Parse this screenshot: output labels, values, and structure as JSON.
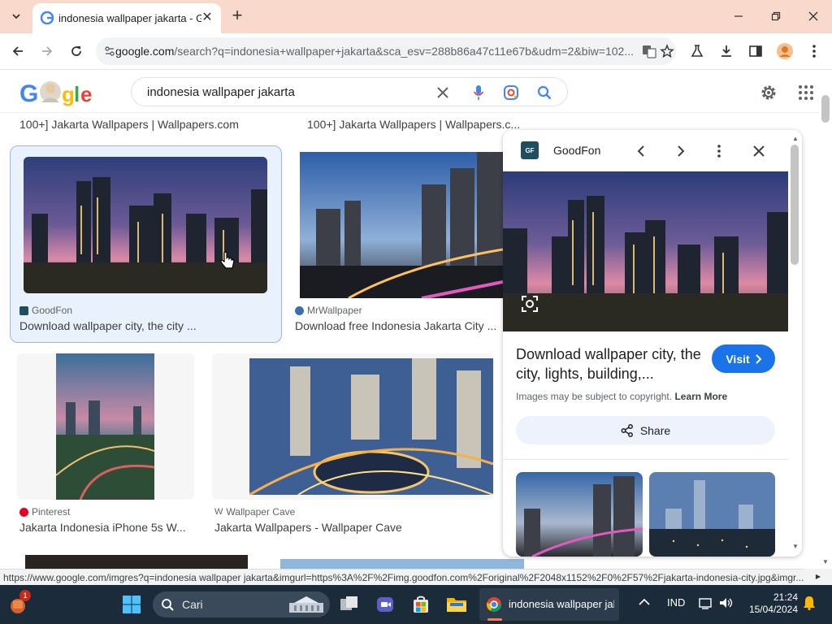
{
  "browser": {
    "tab": {
      "title": "indonesia wallpaper jakarta - G"
    },
    "url": {
      "host": "google.com",
      "path": "/search?q=indonesia+wallpaper+jakarta&sca_esv=288b86a47c11e67b&udm=2&biw=102..."
    },
    "status_url": "https://www.google.com/imgres?q=indonesia wallpaper jakarta&imgurl=https%3A%2F%2Fimg.goodfon.com%2Foriginal%2F2048x1152%2F0%2F57%2Fjakarta-indonesia-city.jpg&imgr..."
  },
  "google": {
    "query": "indonesia wallpaper jakarta"
  },
  "results": {
    "top_row": [
      {
        "title": "100+] Jakarta Wallpapers | Wallpapers.com"
      },
      {
        "title": "100+] Jakarta Wallpapers | Wallpapers.c..."
      }
    ],
    "row1": [
      {
        "source": "GoodFon",
        "title": "Download wallpaper city, the city ..."
      },
      {
        "source": "MrWallpaper",
        "title": "Download free Indonesia Jakarta City ..."
      }
    ],
    "row2": [
      {
        "source": "Pinterest",
        "title": "Jakarta Indonesia iPhone 5s W..."
      },
      {
        "source": "Wallpaper Cave",
        "title": "Jakarta Wallpapers - Wallpaper Cave"
      }
    ]
  },
  "panel": {
    "source_logo": "GF",
    "source": "GoodFon",
    "title": "Download wallpaper city, the city, lights, building,...",
    "visit_label": "Visit",
    "copyright": "Images may be subject to copyright.",
    "learn_more": "Learn More",
    "share_label": "Share"
  },
  "taskbar": {
    "search_label": "Cari",
    "active_app_label": "indonesia wallpaper jak",
    "language": "IND",
    "time": "21:24",
    "date": "15/04/2024",
    "notification_count": "1"
  },
  "colors": {
    "tab_strip": "#f9d9cc",
    "accent_blue": "#1a73e8",
    "taskbar": "#1c2b3a"
  }
}
